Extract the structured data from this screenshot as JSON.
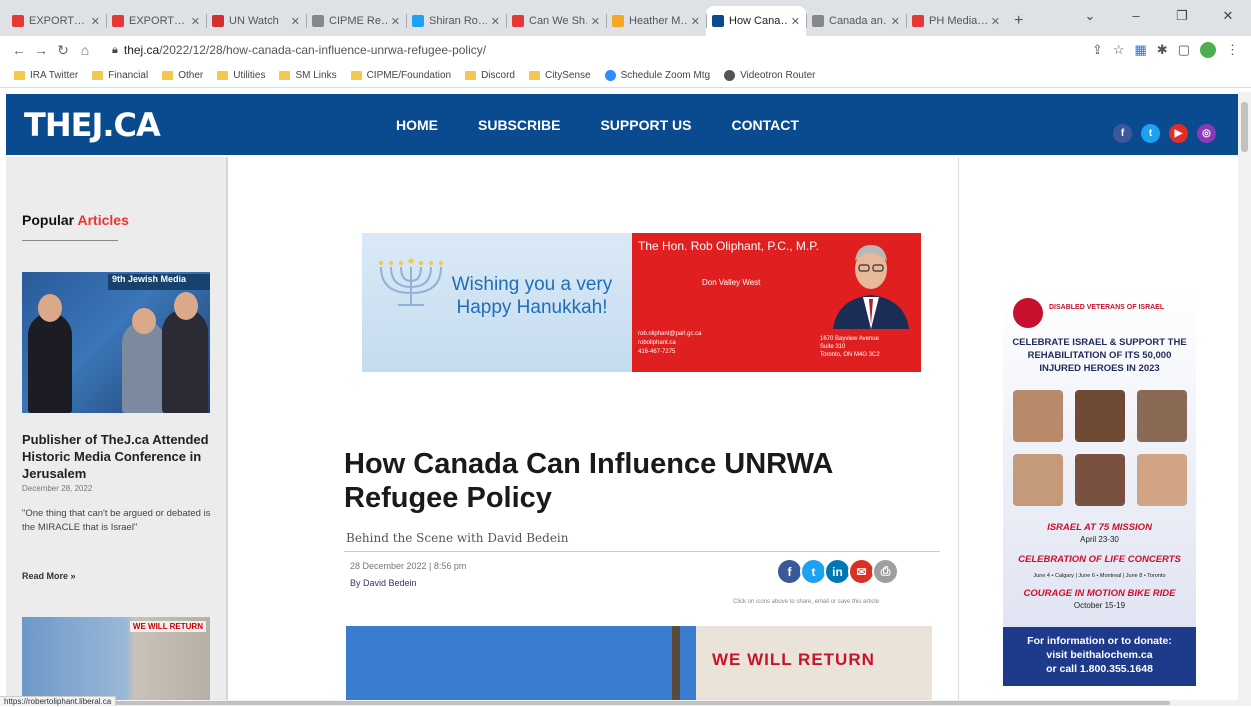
{
  "browser": {
    "tabs": [
      {
        "title": "EXPORT…",
        "color": "#e53935"
      },
      {
        "title": "EXPORT…",
        "color": "#e53935"
      },
      {
        "title": "UN Watch",
        "color": "#d32f2f"
      },
      {
        "title": "CIPME Re…",
        "color": "#888888"
      },
      {
        "title": "Shiran Ro…",
        "color": "#1da1f2"
      },
      {
        "title": "Can We Sh…",
        "color": "#e53935"
      },
      {
        "title": "Heather M…",
        "color": "#f6a623"
      },
      {
        "title": "How Cana…",
        "color": "#0a4a8f",
        "active": true
      },
      {
        "title": "Canada an…",
        "color": "#888888"
      },
      {
        "title": "PH Media…",
        "color": "#e53935"
      }
    ],
    "url_domain": "thej.ca",
    "url_path": "/2022/12/28/how-canada-can-influence-unrwa-refugee-policy/",
    "bookmarks": [
      {
        "label": "IRA Twitter",
        "type": "folder"
      },
      {
        "label": "Financial",
        "type": "folder"
      },
      {
        "label": "Other",
        "type": "folder"
      },
      {
        "label": "Utilities",
        "type": "folder"
      },
      {
        "label": "SM Links",
        "type": "folder"
      },
      {
        "label": "CIPME/Foundation",
        "type": "folder"
      },
      {
        "label": "Discord",
        "type": "folder"
      },
      {
        "label": "CitySense",
        "type": "folder"
      },
      {
        "label": "Schedule Zoom Mtg",
        "type": "link",
        "color": "#2d8cff"
      },
      {
        "label": "Videotron Router",
        "type": "link",
        "color": "#555555"
      }
    ],
    "status_url": "https://robertoliphant.liberal.ca"
  },
  "site": {
    "logo": "THEJ.CA",
    "nav": [
      "HOME",
      "SUBSCRIBE",
      "SUPPORT US",
      "CONTACT"
    ],
    "social": [
      {
        "icon": "facebook-icon",
        "glyph": "f",
        "color": "#3b5998"
      },
      {
        "icon": "twitter-icon",
        "glyph": "t",
        "color": "#1da1f2"
      },
      {
        "icon": "youtube-icon",
        "glyph": "▶",
        "color": "#e52d27"
      },
      {
        "icon": "instagram-icon",
        "glyph": "◎",
        "color": "#8a3ab9"
      }
    ]
  },
  "sidebar": {
    "popular_prefix": "Popular ",
    "popular_accent": "Articles",
    "img_banner": "9th Jewish Media",
    "headline": "Publisher of TheJ.ca Attended Historic Media Conference in Jerusalem",
    "date": "December 28, 2022",
    "quote": "\"One thing that can't be argued or debated is the MIRACLE that is Israel\"",
    "read_more": "Read More »",
    "img2_sign": "WE WILL RETURN"
  },
  "ad_hanukkah": {
    "greeting": "Wishing you a very Happy Hanukkah!",
    "mp_name": "The Hon. Rob Oliphant, P.C., M.P.",
    "riding": "Don Valley West",
    "email": "rob.oliphant@parl.gc.ca",
    "web": "roboliphant.ca",
    "phone": "416-467-7275",
    "addr1": "1670 Bayview Avenue",
    "addr2": "Suite 310",
    "addr3": "Toronto, ON M4G 3C2"
  },
  "article": {
    "title": "How Canada Can Influence UNRWA Refugee Policy",
    "subtitle": "Behind the Scene with David Bedein",
    "date": "28 December 2022  |  8:56 pm",
    "byline": "By David Bedein",
    "share_note": "Click on icons above to share, email or save this article",
    "hero_text": "WE WILL RETURN"
  },
  "ad_dv": {
    "org": "DISABLED VETERANS OF ISRAEL",
    "headline": "CELEBRATE ISRAEL & SUPPORT THE REHABILITATION OF ITS 50,000 INJURED HEROES IN 2023",
    "mission": "ISRAEL AT 75 MISSION",
    "mission_dates": "April 23-30",
    "concerts": "CELEBRATION OF LIFE CONCERTS",
    "concert_dates": "June 4 • Calgary  |  June 6 • Montreal  |  June 8 • Toronto",
    "bike": "COURAGE IN MOTION BIKE RIDE",
    "bike_dates": "October 15-19",
    "info1": "For information or to donate:",
    "info2": "visit beithalochem.ca",
    "info3": "or call 1.800.355.1648"
  },
  "share_buttons": [
    {
      "icon": "facebook-share-icon",
      "glyph": "f",
      "color": "#3b5998"
    },
    {
      "icon": "twitter-share-icon",
      "glyph": "t",
      "color": "#1da1f2"
    },
    {
      "icon": "linkedin-share-icon",
      "glyph": "in",
      "color": "#0077b5"
    },
    {
      "icon": "email-share-icon",
      "glyph": "✉",
      "color": "#d93025"
    },
    {
      "icon": "print-share-icon",
      "glyph": "⎙",
      "color": "#9e9e9e"
    }
  ]
}
